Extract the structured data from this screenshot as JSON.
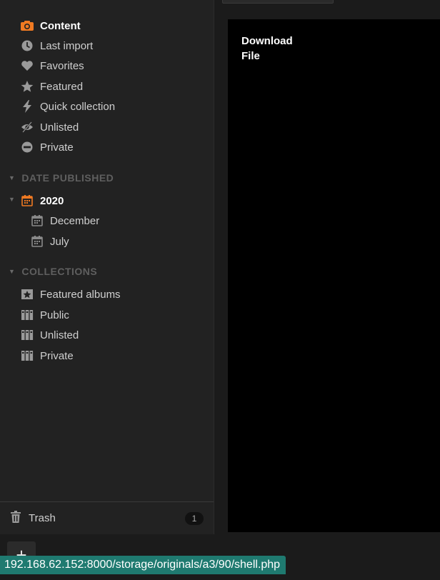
{
  "sidebar": {
    "smart": [
      {
        "label": "Content",
        "icon": "camera-icon",
        "active": true
      },
      {
        "label": "Last import",
        "icon": "clock-icon"
      },
      {
        "label": "Favorites",
        "icon": "heart-icon"
      },
      {
        "label": "Featured",
        "icon": "star-icon"
      },
      {
        "label": "Quick collection",
        "icon": "bolt-icon"
      },
      {
        "label": "Unlisted",
        "icon": "eye-slash-icon"
      },
      {
        "label": "Private",
        "icon": "minus-circle-icon"
      }
    ],
    "date_section": "DATE PUBLISHED",
    "year": "2020",
    "months": [
      "December",
      "July"
    ],
    "collections_section": "COLLECTIONS",
    "collections": [
      {
        "label": "Featured albums",
        "icon": "star-album-icon"
      },
      {
        "label": "Public",
        "icon": "album-icon"
      },
      {
        "label": "Unlisted",
        "icon": "album-icon"
      },
      {
        "label": "Private",
        "icon": "album-icon"
      }
    ],
    "trash": {
      "label": "Trash",
      "count": "1"
    }
  },
  "viewer": {
    "download_label": "Download File"
  },
  "add_button": "+",
  "status_url": "192.168.62.152:8000/storage/originals/a3/90/shell.php",
  "colors": {
    "accent": "#f07a22",
    "status_bg": "#1f7a70"
  }
}
